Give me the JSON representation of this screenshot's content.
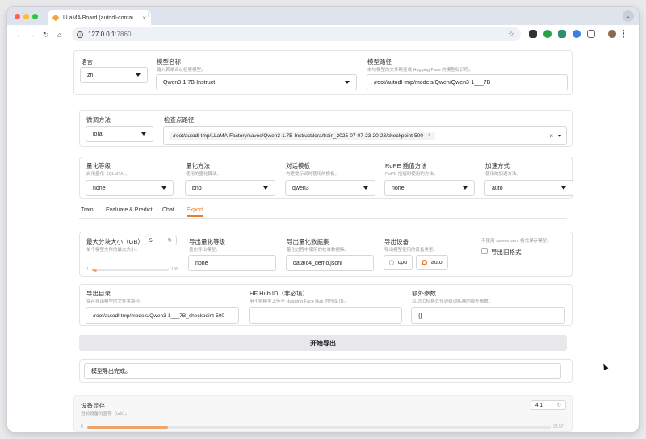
{
  "browser": {
    "tab_title": "LLaMA Board (autodl-contai",
    "tab_close": "×",
    "new_tab": "+",
    "tabs_menu": "⌄",
    "url_host": "127.0.0.1",
    "url_port": ":7860",
    "info": "i",
    "nav_back": "←",
    "nav_forward": "→",
    "nav_reload": "↻",
    "nav_home": "⌂",
    "star": "☆"
  },
  "top": {
    "language_label": "语言",
    "language_value": "zh",
    "model_name_label": "模型名称",
    "model_name_sub": "输入首单词以检索模型。",
    "model_name_value": "Qwen3-1.7B-Instruct",
    "model_path_label": "模型路径",
    "model_path_sub": "本地模型的文件路径或 Hugging Face 的模型标识符。",
    "model_path_value": "/root/autodl-tmp/models/Qwen/Qwen3-1___7B"
  },
  "finetune": {
    "method_label": "微调方法",
    "method_value": "lora",
    "checkpoint_label": "检查点路径",
    "checkpoint_value": "/root/autodl-tmp/LLaMA-Factory/saves/Qwen3-1.7B-Instruct/lora/train_2025-07-07-23-20-23/checkpoint-500",
    "chip_x": "×",
    "clear_x": "×"
  },
  "quant": {
    "level_label": "量化等级",
    "level_sub": "启用量化（QLoRA）。",
    "level_value": "none",
    "method_label": "量化方法",
    "method_sub": "使用的量化算法。",
    "method_value": "bnb",
    "template_label": "对话模板",
    "template_sub": "构建提示词时使用的模板。",
    "template_value": "qwen3",
    "rope_label": "RoPE 插值方法",
    "rope_sub": "RoPE 插值时使用的方法。",
    "rope_value": "none",
    "accel_label": "加速方式",
    "accel_sub": "使用的加速方法。",
    "accel_value": "auto"
  },
  "tabs": [
    "Train",
    "Evaluate & Predict",
    "Chat",
    "Export"
  ],
  "export": {
    "shard_label": "最大分块大小（GB）",
    "shard_sub": "单个模型文件的最大大小。",
    "shard_value": "5",
    "shard_min": "1",
    "shard_max": "100",
    "shard_fraction": 0.04,
    "quant_bit_label": "导出量化等级",
    "quant_bit_sub": "量化导出模型。",
    "quant_bit_value": "none",
    "quant_dataset_label": "导出量化数据集",
    "quant_dataset_sub": "量化过程中使用的校准数据集。",
    "quant_dataset_value": "data/c4_demo.jsonl",
    "device_label": "导出设备",
    "device_sub": "导出模型使用的设备类型。",
    "device_cpu": "cpu",
    "device_auto": "auto",
    "legacy_sub": "不使用 safetensors 格式保存模型。",
    "legacy_label": "导出旧格式",
    "dir_label": "导出目录",
    "dir_sub": "保存导出模型的文件夹路径。",
    "dir_value": "/root/autodl-tmp/models/Qwen3-1___7B_checkpoint-500",
    "hub_label": "HF Hub ID（非必填）",
    "hub_sub": "用于将模型上传至 Hugging Face Hub 的仓库 ID。",
    "hub_value": "",
    "extra_label": "额外参数",
    "extra_sub": "以 JSON 格式传递给训练器的额外参数。",
    "extra_value": "{}",
    "button_label": "开始导出",
    "output_text": "模型导出完成。"
  },
  "memory": {
    "label": "设备显存",
    "sub": "当前设备的显存（GB）。",
    "value": "4.1",
    "min": "0",
    "max": "23.57",
    "fraction": 0.174
  },
  "colors": {
    "accent": "#ea7b2a",
    "slider_fill": "#f0a46d"
  }
}
